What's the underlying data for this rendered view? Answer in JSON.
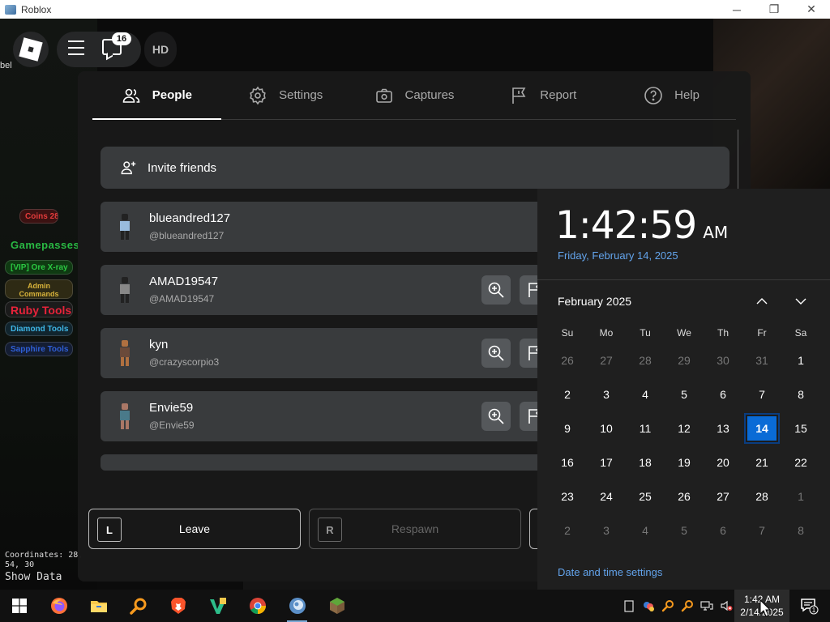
{
  "window": {
    "title": "Roblox",
    "minimize_glyph": "─",
    "restore_glyph": "❐",
    "close_glyph": "✕"
  },
  "topbar": {
    "chat_badge": "16",
    "hd_label": "HD",
    "edge_label": "bel"
  },
  "hud": {
    "gamepasses_label": "Gamepasses",
    "coordinates_text": "Coordinates: 28, 54, 30",
    "show_data_label": "Show Data",
    "items": [
      {
        "label": "Coins 28",
        "color": "#e23b3b",
        "bg": "#3b1212"
      },
      {
        "label": "[VIP] Ore X-ray",
        "color": "#2bc742",
        "bg": "#0f3a12"
      },
      {
        "label": "Admin Commands",
        "color": "#d8b33a",
        "bg": "#2e2a14"
      },
      {
        "label": "Ruby Tools",
        "color": "#e8233a",
        "bg": "#1b1b1b"
      },
      {
        "label": "Diamond Tools",
        "color": "#3fb6e6",
        "bg": "#11252e"
      },
      {
        "label": "Sapphire Tools",
        "color": "#2f5fd6",
        "bg": "#141d33"
      }
    ]
  },
  "menu": {
    "tabs": [
      {
        "label": "People",
        "icon": "people-icon"
      },
      {
        "label": "Settings",
        "icon": "gear-icon"
      },
      {
        "label": "Captures",
        "icon": "camera-icon"
      },
      {
        "label": "Report",
        "icon": "flag-icon"
      },
      {
        "label": "Help",
        "icon": "help-icon"
      }
    ],
    "active_tab": "People",
    "invite_label": "Invite friends",
    "players": [
      {
        "name": "blueandred127",
        "handle": "@blueandred127"
      },
      {
        "name": "AMAD19547",
        "handle": "@AMAD19547"
      },
      {
        "name": "kyn",
        "handle": "@crazyscorpio3"
      },
      {
        "name": "Envie59",
        "handle": "@Envie59"
      }
    ],
    "leave": {
      "key": "L",
      "label": "Leave"
    },
    "respawn": {
      "key": "R",
      "label": "Respawn"
    }
  },
  "flyout": {
    "time": "1:42:59",
    "ampm": "AM",
    "long_date": "Friday, February 14, 2025",
    "month_label": "February 2025",
    "weekdays": [
      "Su",
      "Mo",
      "Tu",
      "We",
      "Th",
      "Fr",
      "Sa"
    ],
    "weeks": [
      [
        [
          "26",
          1
        ],
        [
          "27",
          1
        ],
        [
          "28",
          1
        ],
        [
          "29",
          1
        ],
        [
          "30",
          1
        ],
        [
          "31",
          1
        ],
        [
          "1",
          0
        ]
      ],
      [
        [
          "2",
          0
        ],
        [
          "3",
          0
        ],
        [
          "4",
          0
        ],
        [
          "5",
          0
        ],
        [
          "6",
          0
        ],
        [
          "7",
          0
        ],
        [
          "8",
          0
        ]
      ],
      [
        [
          "9",
          0
        ],
        [
          "10",
          0
        ],
        [
          "11",
          0
        ],
        [
          "12",
          0
        ],
        [
          "13",
          0
        ],
        [
          "14",
          0
        ],
        [
          "15",
          0
        ]
      ],
      [
        [
          "16",
          0
        ],
        [
          "17",
          0
        ],
        [
          "18",
          0
        ],
        [
          "19",
          0
        ],
        [
          "20",
          0
        ],
        [
          "21",
          0
        ],
        [
          "22",
          0
        ]
      ],
      [
        [
          "23",
          0
        ],
        [
          "24",
          0
        ],
        [
          "25",
          0
        ],
        [
          "26",
          0
        ],
        [
          "27",
          0
        ],
        [
          "28",
          0
        ],
        [
          "1",
          1
        ]
      ],
      [
        [
          "2",
          1
        ],
        [
          "3",
          1
        ],
        [
          "4",
          1
        ],
        [
          "5",
          1
        ],
        [
          "6",
          1
        ],
        [
          "7",
          1
        ],
        [
          "8",
          1
        ]
      ]
    ],
    "today": "14",
    "settings_link": "Date and time settings"
  },
  "taskbar": {
    "apps": [
      "firefox-icon",
      "file-explorer-icon",
      "search-tool-icon",
      "brave-icon",
      "vs-icon",
      "chrome-icon",
      "roblox-player-icon",
      "minecraft-icon"
    ],
    "tray": [
      "clipboard-icon",
      "network-warning-icon",
      "search-tool-icon",
      "search-tool-icon",
      "network-icon",
      "volume-muted-icon"
    ],
    "clock_time": "1:42 AM",
    "clock_date": "2/14/2025",
    "notification_count": "1"
  },
  "colors": {
    "accent_blue": "#0a6bd6",
    "link_blue": "#63a4ec"
  }
}
